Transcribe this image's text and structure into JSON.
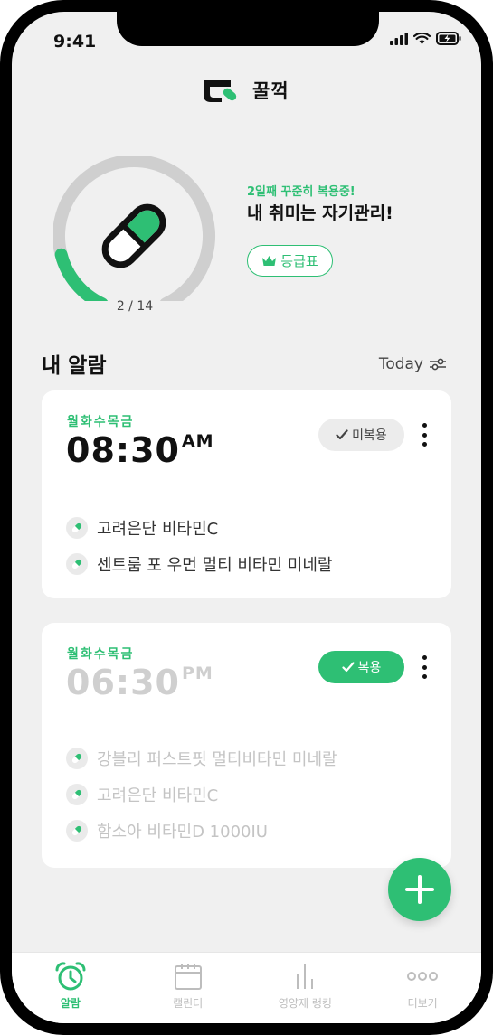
{
  "status_bar": {
    "time": "9:41"
  },
  "brand": {
    "name": "꿀꺽"
  },
  "progress": {
    "current": 2,
    "total": 14,
    "label": "2 / 14",
    "streak_text": "2일째 꾸준히 복용중!",
    "headline": "내 취미는 자기관리!",
    "grade_label": "등급표"
  },
  "alarms_section": {
    "title": "내 알람",
    "filter_label": "Today"
  },
  "alarms": [
    {
      "days": "월화수목금",
      "time": "08:30",
      "ampm": "AM",
      "status": "미복용",
      "taken": false,
      "items": [
        "고려은단 비타민C",
        "센트룸 포 우먼 멀티 비타민 미네랄"
      ]
    },
    {
      "days": "월화수목금",
      "time": "06:30",
      "ampm": "PM",
      "status": "복용",
      "taken": true,
      "items": [
        "강블리 퍼스트핏 멀티비타민 미네랄",
        "고려은단 비타민C",
        "함소아 비타민D 1000IU"
      ]
    }
  ],
  "tabbar": {
    "items": [
      {
        "label": "알람",
        "icon": "alarm-clock-icon",
        "active": true
      },
      {
        "label": "캘린더",
        "icon": "calendar-icon",
        "active": false
      },
      {
        "label": "영양제 랭킹",
        "icon": "ranking-bars-icon",
        "active": false
      },
      {
        "label": "더보기",
        "icon": "more-dots-icon",
        "active": false
      }
    ]
  },
  "colors": {
    "accent": "#2ebf74",
    "background": "#f0f0f0",
    "card": "#ffffff",
    "gauge_track": "#cfcfcf",
    "muted_text": "#c4c4c4"
  }
}
